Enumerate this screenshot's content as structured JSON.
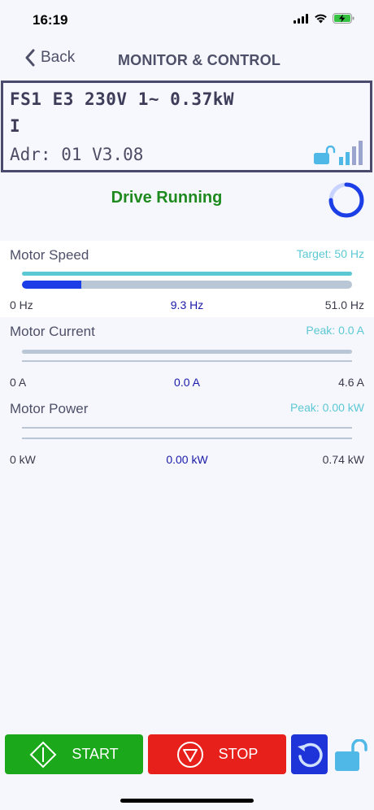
{
  "status_bar": {
    "time": "16:19"
  },
  "nav": {
    "back_label": "Back",
    "title": "MONITOR & CONTROL"
  },
  "device": {
    "line1": "FS1 E3 230V 1~ 0.37kW",
    "line2": "I",
    "line3": "Adr: 01 V3.08"
  },
  "drive_status": "Drive Running",
  "speed": {
    "label": "Motor Speed",
    "target": "Target: 50 Hz",
    "min": "0 Hz",
    "value": "9.3 Hz",
    "max": "51.0 Hz",
    "fill_fraction": 0.18
  },
  "current": {
    "label": "Motor Current",
    "peak": "Peak:  0.0 A",
    "min": "0 A",
    "value": "0.0 A",
    "max": "4.6 A",
    "fill_fraction": 0.0
  },
  "power": {
    "label": "Motor Power",
    "peak": "Peak: 0.00 kW",
    "min": "0 kW",
    "value": "0.00 kW",
    "max": "0.74 kW",
    "fill_fraction": 0.0
  },
  "controls": {
    "start_label": "START",
    "stop_label": "STOP"
  },
  "colors": {
    "running": "#1e8a1e",
    "start": "#1ba81b",
    "stop": "#e8201c",
    "reset": "#1e33d8",
    "accent": "#5cc8d4",
    "fill": "#1c3ee6"
  },
  "icons": [
    "back-chevron-icon",
    "signal-icon",
    "wifi-icon",
    "battery-charging-icon",
    "unlock-icon",
    "signal-strength-icon",
    "spinner-icon",
    "start-diamond-icon",
    "stop-icon",
    "reset-icon"
  ]
}
